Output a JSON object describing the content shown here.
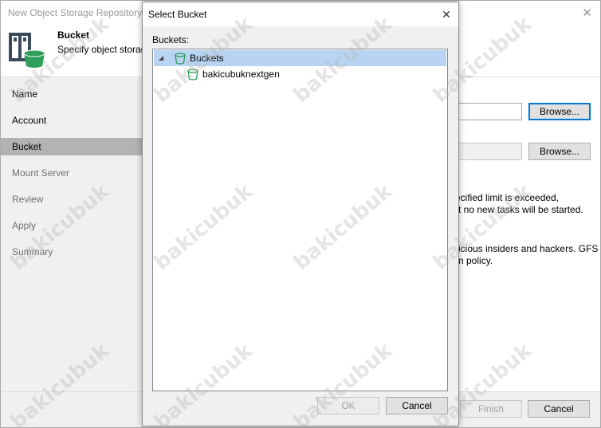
{
  "wizard": {
    "title": "New Object Storage Repository",
    "close_glyph": "✕",
    "header": {
      "title": "Bucket",
      "subtitle": "Specify object storage"
    },
    "steps": [
      {
        "label": "Name"
      },
      {
        "label": "Account"
      },
      {
        "label": "Bucket"
      },
      {
        "label": "Mount Server"
      },
      {
        "label": "Review"
      },
      {
        "label": "Apply"
      },
      {
        "label": "Summary"
      }
    ],
    "active_step": "Bucket",
    "main": {
      "browse1_label": "Browse...",
      "browse2_label": "Browse...",
      "text_line1": "ecified limit is exceeded,",
      "text_line2": "t no new tasks will be started.",
      "text_line3": "icious insiders and hackers. GFS",
      "text_line4": "n policy."
    },
    "footer": {
      "finish_label": "Finish",
      "cancel_label": "Cancel"
    }
  },
  "dialog": {
    "title": "Select Bucket",
    "close_glyph": "✕",
    "list_label": "Buckets:",
    "tree": {
      "root": {
        "label": "Buckets",
        "expanded": true,
        "selected": true,
        "icon": "bucket-icon"
      },
      "children": [
        {
          "label": "bakicubuknextgen",
          "icon": "bucket-icon"
        }
      ]
    },
    "ok_label": "OK",
    "cancel_label": "Cancel"
  },
  "colors": {
    "selection": "#b8d4f2",
    "active_step": "#b3b3b3",
    "focus_border": "#0078d7",
    "bucket_green": "#2e9e5b"
  },
  "watermark": "bakicubuk"
}
